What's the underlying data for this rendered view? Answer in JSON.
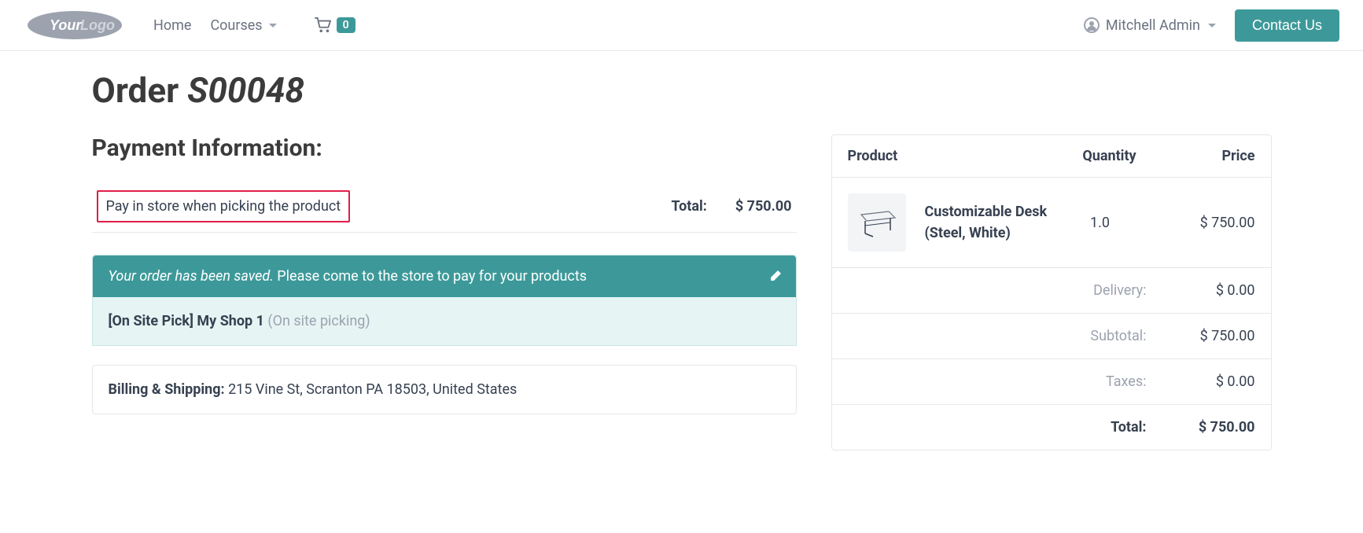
{
  "header": {
    "logo_text_your": "Your",
    "logo_text_logo": "Logo",
    "nav": {
      "home": "Home",
      "courses": "Courses"
    },
    "cart_count": "0",
    "user_name": "Mitchell Admin",
    "contact_label": "Contact Us"
  },
  "page": {
    "title_prefix": "Order ",
    "title_order": "S00048"
  },
  "payment": {
    "section_title": "Payment Information:",
    "method_text": "Pay in store when picking the product",
    "total_label": "Total:",
    "total_value": "$ 750.00"
  },
  "notice": {
    "saved_em": "Your order has been saved.",
    "saved_rest": " Please come to the store to pay for your products",
    "pickup_prefix": "[On Site Pick] My Shop 1 ",
    "pickup_muted": "(On site picking)"
  },
  "billing": {
    "label": "Billing & Shipping: ",
    "address": "215 Vine St, Scranton PA 18503, United States"
  },
  "summary": {
    "col_product": "Product",
    "col_qty": "Quantity",
    "col_price": "Price",
    "items": {
      "0": {
        "name": "Customizable Desk (Steel, White)",
        "qty": "1.0",
        "price": "$ 750.00"
      }
    },
    "delivery_label": "Delivery:",
    "delivery_value": "$ 0.00",
    "subtotal_label": "Subtotal:",
    "subtotal_value": "$ 750.00",
    "taxes_label": "Taxes:",
    "taxes_value": "$ 0.00",
    "total_label": "Total:",
    "total_value": "$ 750.00"
  }
}
